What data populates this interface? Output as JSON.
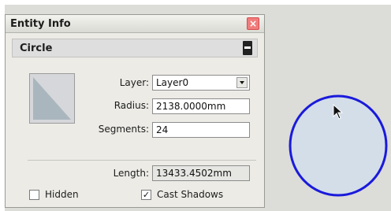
{
  "panel": {
    "title": "Entity Info",
    "close_symbol": "×",
    "section_title": "Circle"
  },
  "fields": {
    "layer_label": "Layer:",
    "layer_value": "Layer0",
    "radius_label": "Radius:",
    "radius_value": "2138.0000mm",
    "segments_label": "Segments:",
    "segments_value": "24",
    "length_label": "Length:",
    "length_value": "13433.4502mm"
  },
  "options": {
    "hidden_label": "Hidden",
    "hidden_checked": false,
    "cast_shadows_label": "Cast Shadows",
    "cast_shadows_checked": true,
    "check_mark": "✓"
  },
  "colors": {
    "circle_fill": "#d3dee9",
    "circle_stroke": "#1a1adb",
    "preview_fill": "#aab6bd"
  },
  "icons": {
    "close": "close-icon",
    "collapse": "collapse-toggle-icon",
    "preview": "circle-preview-icon",
    "cursor": "mouse-pointer-icon"
  }
}
